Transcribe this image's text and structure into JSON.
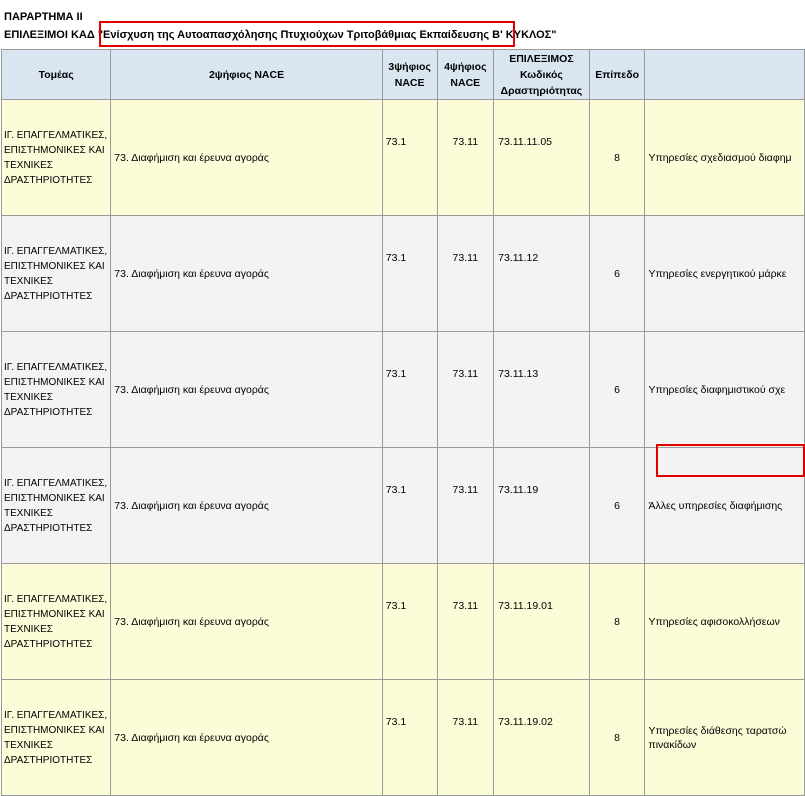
{
  "header": {
    "annex": "ΠΑΡΑΡΤΗΜΑ ΙΙ",
    "prefix": "ΕΠΙΛΕΞΙΜΟΙ ΚΑΔ",
    "program": "\"Ενίσχυση της Αυτοαπασχόλησης Πτυχιούχων Τριτοβάθμιας Εκπαίδευσης",
    "suffix": " Β' ΚΥΚΛΟΣ\""
  },
  "columns": {
    "sector": "Τομέας",
    "nace2": "2ψήφιος NACE",
    "nace3": "3ψήφιος NACE",
    "nace4": "4ψήφιος NACE",
    "code": "ΕΠΙΛΕΞΙΜΟΣ Κωδικός Δραστηριότητας",
    "level": "Επίπεδο",
    "desc": ""
  },
  "rows": [
    {
      "sector": "ΙΓ. ΕΠΑΓΓΕΛΜΑΤΙΚΕΣ, ΕΠΙΣΤΗΜΟΝΙΚΕΣ ΚΑΙ ΤΕΧΝΙΚΕΣ ΔΡΑΣΤΗΡΙΟΤΗΤΕΣ",
      "nace2": "73. Διαφήμιση και έρευνα αγοράς",
      "nace3": "73.1",
      "nace4": "73.11",
      "code": "73.11.11.05",
      "level": "8",
      "desc": "Υπηρεσίες σχεδιασμού διαφημ"
    },
    {
      "sector": "ΙΓ. ΕΠΑΓΓΕΛΜΑΤΙΚΕΣ, ΕΠΙΣΤΗΜΟΝΙΚΕΣ ΚΑΙ ΤΕΧΝΙΚΕΣ ΔΡΑΣΤΗΡΙΟΤΗΤΕΣ",
      "nace2": "73. Διαφήμιση και έρευνα αγοράς",
      "nace3": "73.1",
      "nace4": "73.11",
      "code": "73.11.12",
      "level": "6",
      "desc": "Υπηρεσίες ενεργητικού μάρκε"
    },
    {
      "sector": "ΙΓ. ΕΠΑΓΓΕΛΜΑΤΙΚΕΣ, ΕΠΙΣΤΗΜΟΝΙΚΕΣ ΚΑΙ ΤΕΧΝΙΚΕΣ ΔΡΑΣΤΗΡΙΟΤΗΤΕΣ",
      "nace2": "73. Διαφήμιση και έρευνα αγοράς",
      "nace3": "73.1",
      "nace4": "73.11",
      "code": "73.11.13",
      "level": "6",
      "desc": "Υπηρεσίες διαφημιστικού σχε"
    },
    {
      "sector": "ΙΓ. ΕΠΑΓΓΕΛΜΑΤΙΚΕΣ, ΕΠΙΣΤΗΜΟΝΙΚΕΣ ΚΑΙ ΤΕΧΝΙΚΕΣ ΔΡΑΣΤΗΡΙΟΤΗΤΕΣ",
      "nace2": "73. Διαφήμιση και έρευνα αγοράς",
      "nace3": "73.1",
      "nace4": "73.11",
      "code": "73.11.19",
      "level": "6",
      "desc": "Άλλες υπηρεσίες διαφήμισης"
    },
    {
      "sector": "ΙΓ. ΕΠΑΓΓΕΛΜΑΤΙΚΕΣ, ΕΠΙΣΤΗΜΟΝΙΚΕΣ ΚΑΙ ΤΕΧΝΙΚΕΣ ΔΡΑΣΤΗΡΙΟΤΗΤΕΣ",
      "nace2": "73. Διαφήμιση και έρευνα αγοράς",
      "nace3": "73.1",
      "nace4": "73.11",
      "code": "73.11.19.01",
      "level": "8",
      "desc": "Υπηρεσίες αφισοκολλήσεων"
    },
    {
      "sector": "ΙΓ. ΕΠΑΓΓΕΛΜΑΤΙΚΕΣ, ΕΠΙΣΤΗΜΟΝΙΚΕΣ ΚΑΙ ΤΕΧΝΙΚΕΣ ΔΡΑΣΤΗΡΙΟΤΗΤΕΣ",
      "nace2": "73. Διαφήμιση και έρευνα αγοράς",
      "nace3": "73.1",
      "nace4": "73.11",
      "code": "73.11.19.02",
      "level": "8",
      "desc": "Υπηρεσίες διάθεσης ταρατσώ πινακίδων"
    }
  ],
  "colors": {
    "header_bg": "#dae5f2",
    "row_yellow": "#fdfcd9",
    "row_grey": "#f3f3f3",
    "highlight": "#e00000"
  }
}
